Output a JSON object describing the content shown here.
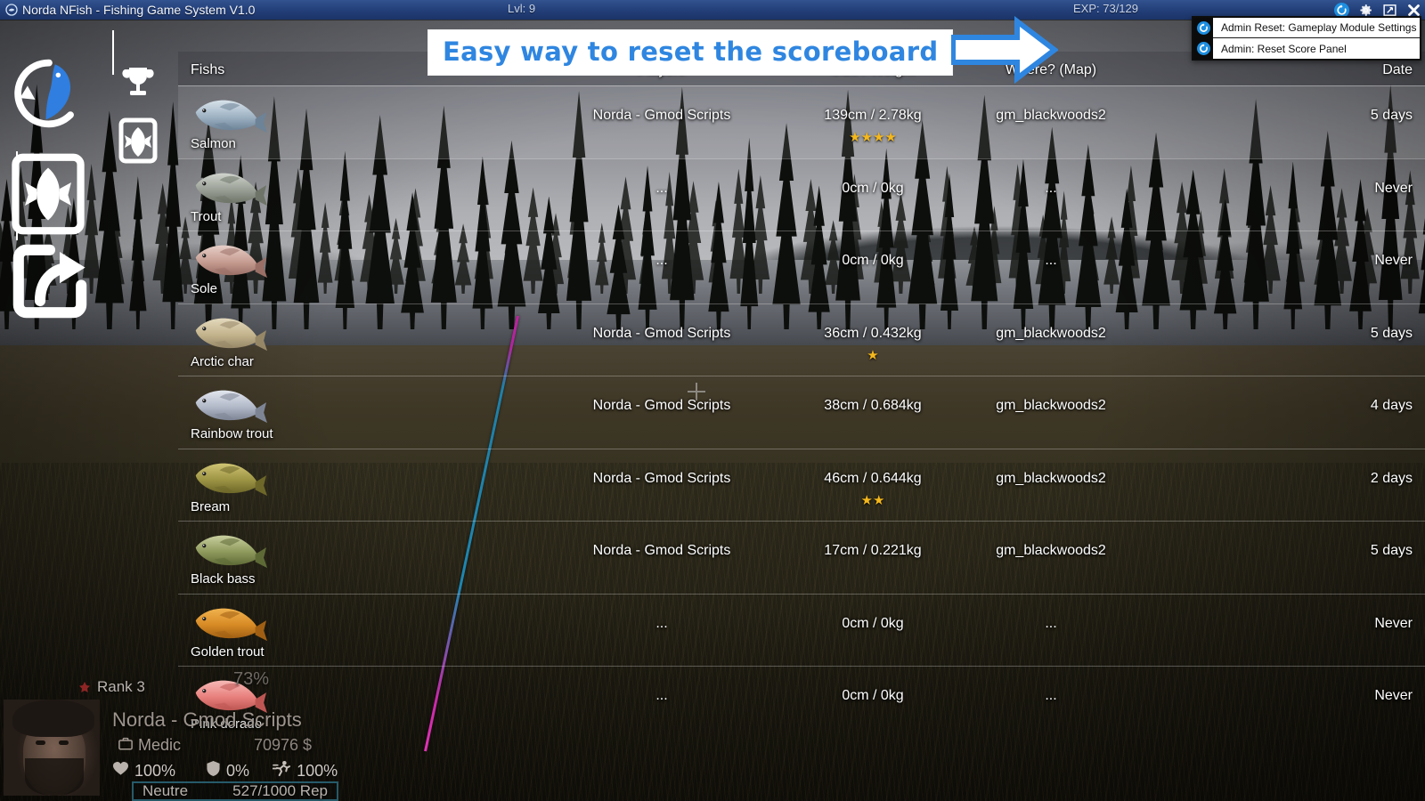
{
  "window": {
    "title": "Norda NFish - Fishing Game System V1.0",
    "logo_icon": "fish-logo-icon",
    "level_text": "Lvl: 9",
    "exp_text": "EXP: 73/129",
    "controls": [
      {
        "name": "refresh-button",
        "icon": "refresh-icon",
        "glyph": "↺"
      },
      {
        "name": "settings-button",
        "icon": "gear-icon",
        "glyph": "⚙"
      },
      {
        "name": "maximize-button",
        "icon": "maximize-icon",
        "glyph": "⤡"
      },
      {
        "name": "close-button",
        "icon": "close-icon",
        "glyph": "✖"
      }
    ]
  },
  "rail": {
    "logo": {
      "label": "NFish logo",
      "icon": "fish-logo-icon"
    },
    "buttons": [
      {
        "name": "fish-card-button",
        "icon": "fish-card-icon"
      },
      {
        "name": "exit-button",
        "icon": "exit-arrow-icon"
      }
    ],
    "sub_buttons": [
      {
        "name": "trophy-tab",
        "icon": "trophy-icon"
      },
      {
        "name": "fish-collection-tab",
        "icon": "fish-card-icon"
      }
    ]
  },
  "annotation": {
    "text": "Easy way to reset the scoreboard",
    "arrow_icon": "right-arrow-icon",
    "text_color": "#2f86e0"
  },
  "admin_panel": {
    "items": [
      {
        "icon": "refresh-icon",
        "label": "Admin Reset: Gameplay Module Settings"
      },
      {
        "icon": "refresh-icon",
        "label": "Admin: Reset Score Panel"
      }
    ]
  },
  "scoreboard": {
    "headers": {
      "fish": "Fishs",
      "player": "Players",
      "size": "Size / Weight",
      "map": "Where? (Map)",
      "date": "Date"
    },
    "rows": [
      {
        "fish": "Salmon",
        "icon": "salmon-icon",
        "player": "Norda - Gmod Scripts",
        "size": "139cm / 2.78kg",
        "stars": "★★★★",
        "star_count": 4,
        "map": "gm_blackwoods2",
        "date": "5 days",
        "highlight": true
      },
      {
        "fish": "Trout",
        "icon": "trout-icon",
        "player": "...",
        "size": "0cm / 0kg",
        "stars": "",
        "star_count": 0,
        "map": "...",
        "date": "Never",
        "highlight": false
      },
      {
        "fish": "Sole",
        "icon": "sole-icon",
        "player": "...",
        "size": "0cm / 0kg",
        "stars": "",
        "star_count": 0,
        "map": "...",
        "date": "Never",
        "highlight": false
      },
      {
        "fish": "Arctic char",
        "icon": "arctic-char-icon",
        "player": "Norda - Gmod Scripts",
        "size": "36cm / 0.432kg",
        "stars": "★",
        "star_count": 1,
        "map": "gm_blackwoods2",
        "date": "5 days",
        "highlight": false
      },
      {
        "fish": "Rainbow trout",
        "icon": "rainbow-trout-icon",
        "player": "Norda - Gmod Scripts",
        "size": "38cm / 0.684kg",
        "stars": "",
        "star_count": 0,
        "map": "gm_blackwoods2",
        "date": "4 days",
        "highlight": false
      },
      {
        "fish": "Bream",
        "icon": "bream-icon",
        "player": "Norda - Gmod Scripts",
        "size": "46cm / 0.644kg",
        "stars": "★★",
        "star_count": 2,
        "map": "gm_blackwoods2",
        "date": "2 days",
        "highlight": false
      },
      {
        "fish": "Black bass",
        "icon": "black-bass-icon",
        "player": "Norda - Gmod Scripts",
        "size": "17cm / 0.221kg",
        "stars": "",
        "star_count": 0,
        "map": "gm_blackwoods2",
        "date": "5 days",
        "highlight": false
      },
      {
        "fish": "Golden trout",
        "icon": "golden-trout-icon",
        "player": "...",
        "size": "0cm / 0kg",
        "stars": "",
        "star_count": 0,
        "map": "...",
        "date": "Never",
        "highlight": false
      },
      {
        "fish": "Pink dorado",
        "icon": "pink-dorado-icon",
        "player": "...",
        "size": "0cm / 0kg",
        "stars": "",
        "star_count": 0,
        "map": "...",
        "date": "Never",
        "highlight": false
      }
    ]
  },
  "hud": {
    "rank": "Rank 3",
    "rank_icon": "rank-badge-icon",
    "exp_percent": "73%",
    "player_name": "Norda - Gmod Scripts",
    "job": "Medic",
    "job_icon": "briefcase-icon",
    "money": "70976 $",
    "health": {
      "icon": "heart-icon",
      "value": "100%"
    },
    "armor": {
      "icon": "shield-icon",
      "value": "0%"
    },
    "stamina": {
      "icon": "runner-icon",
      "value": "100%"
    },
    "reputation_label": "Neutre",
    "reputation_value": "527/1000 Rep"
  },
  "colors": {
    "accent_blue": "#2f86e0",
    "star_gold": "#f5b81c",
    "titlebar": "#24407a",
    "refresh_blue": "#1e8fe0"
  }
}
